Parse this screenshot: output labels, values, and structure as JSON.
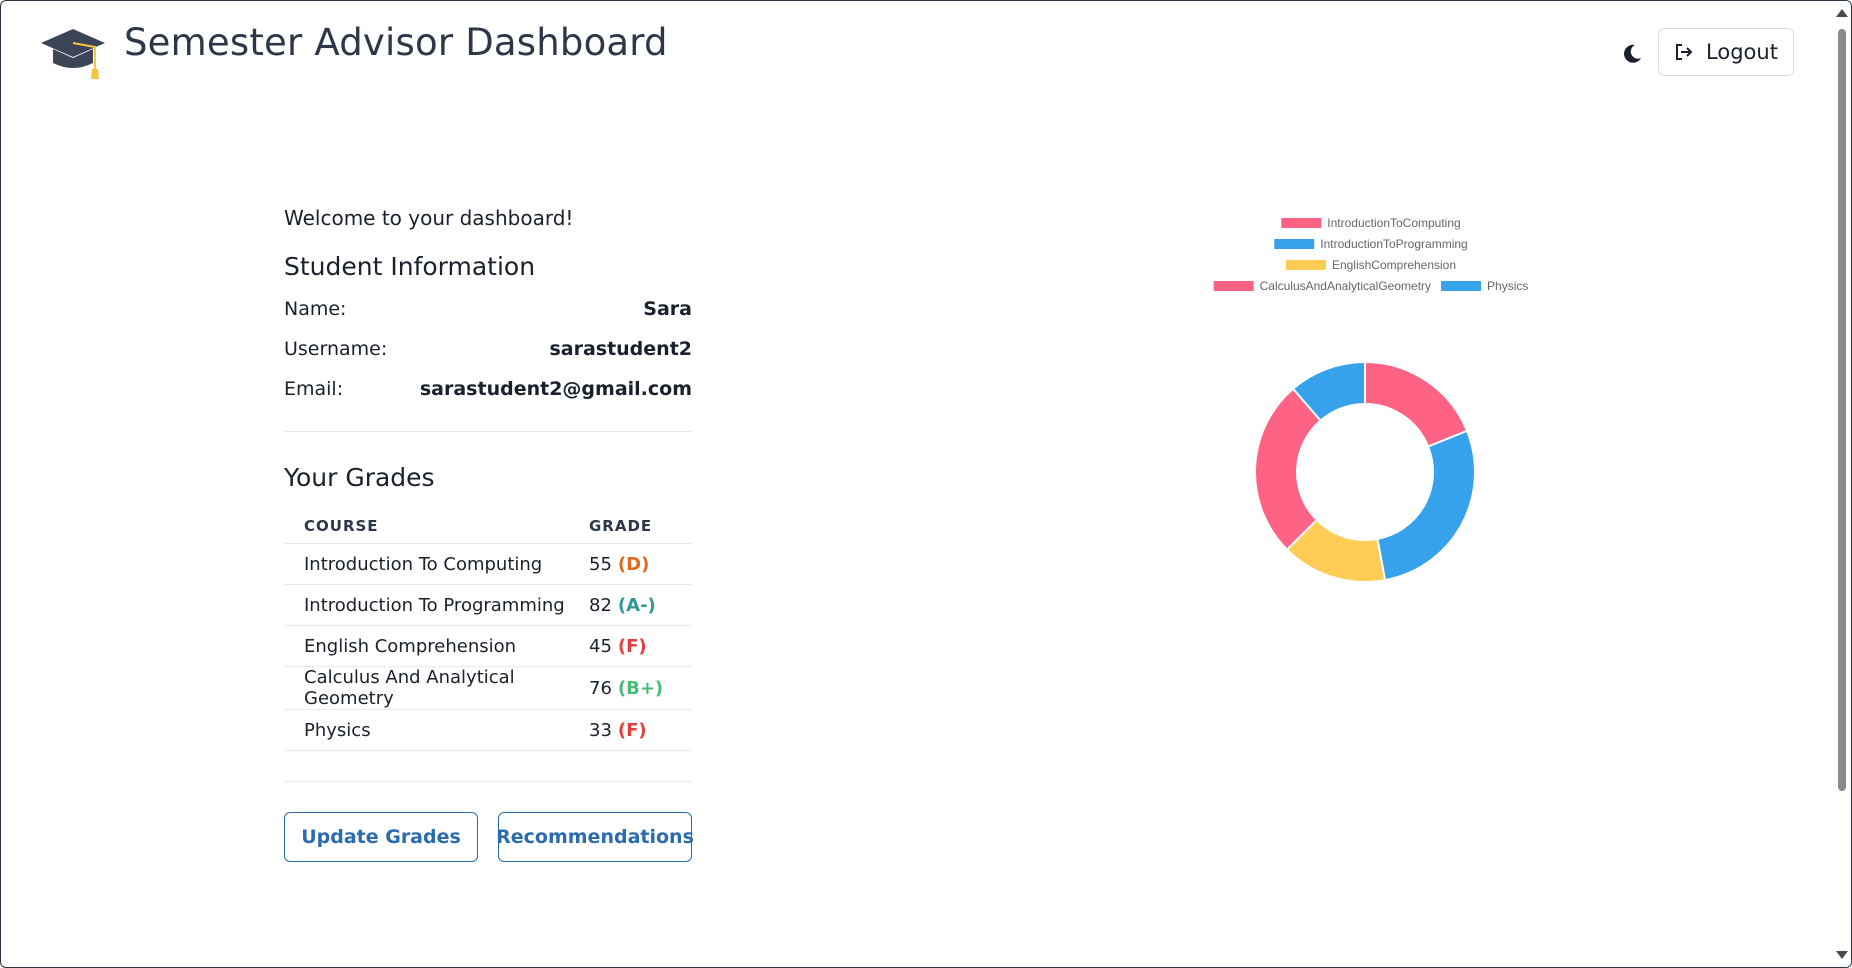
{
  "header": {
    "title": "Semester Advisor Dashboard",
    "logout_label": "Logout",
    "logo_icon": "graduation-cap-icon",
    "theme_icon": "moon-icon",
    "logout_icon": "logout-icon"
  },
  "welcome": "Welcome to your dashboard!",
  "student_info": {
    "title": "Student Information",
    "name_label": "Name:",
    "name": "Sara",
    "username_label": "Username:",
    "username": "sarastudent2",
    "email_label": "Email:",
    "email": "sarastudent2@gmail.com"
  },
  "grades": {
    "title": "Your Grades",
    "col_course": "COURSE",
    "col_grade": "GRADE",
    "rows": [
      {
        "course": "Introduction To Computing",
        "score": "55",
        "letter": "(D)",
        "color": "#dd6b20"
      },
      {
        "course": "Introduction To Programming",
        "score": "82",
        "letter": "(A-)",
        "color": "#319795"
      },
      {
        "course": "English Comprehension",
        "score": "45",
        "letter": "(F)",
        "color": "#e53e3e"
      },
      {
        "course": "Calculus And Analytical Geometry",
        "score": "76",
        "letter": "(B+)",
        "color": "#48bb78"
      },
      {
        "course": "Physics",
        "score": "33",
        "letter": "(F)",
        "color": "#e53e3e"
      }
    ]
  },
  "actions": {
    "update_label": "Update Grades",
    "recommend_label": "Recommendations"
  },
  "chart_data": {
    "type": "pie",
    "variant": "doughnut",
    "legend_position": "top",
    "labels": [
      "IntroductionToComputing",
      "IntroductionToProgramming",
      "EnglishComprehension",
      "CalculusAndAnalyticalGeometry",
      "Physics"
    ],
    "values": [
      55,
      82,
      45,
      76,
      33
    ],
    "colors": [
      "#ff6384",
      "#36a2eb",
      "#ffcd56",
      "#ff6384",
      "#36a2eb"
    ]
  }
}
